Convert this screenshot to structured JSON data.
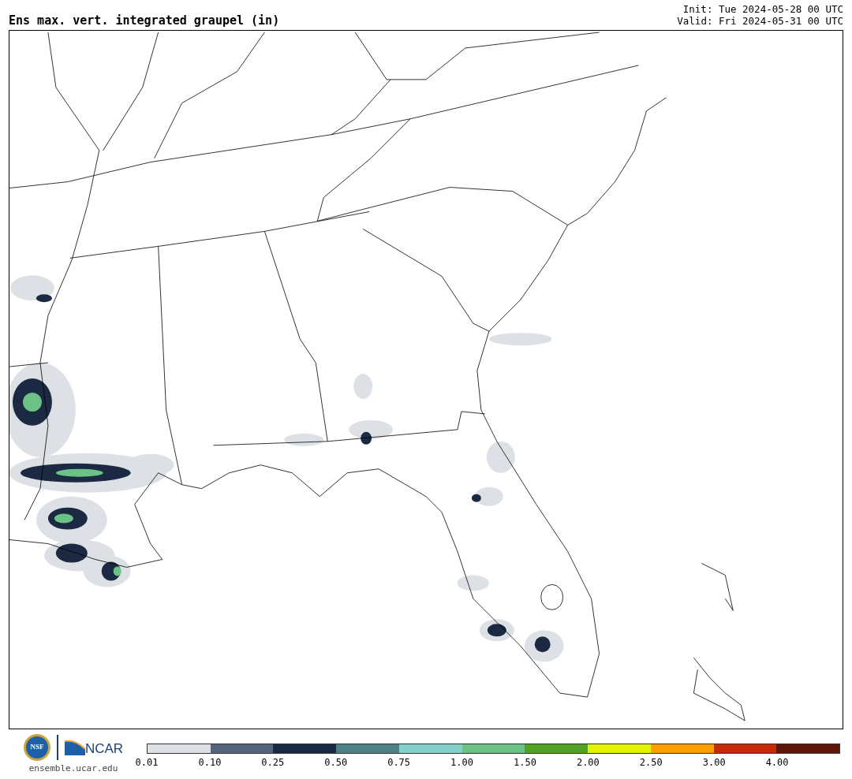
{
  "title": "Ens max. vert. integrated graupel (in)",
  "init": "Init: Tue 2024-05-28 00 UTC",
  "valid": "Valid: Fri 2024-05-31 00 UTC",
  "logos": {
    "seal_text": "NSF",
    "wordmark": "NCAR",
    "site": "ensemble.ucar.edu"
  },
  "legend": {
    "bins": [
      {
        "color": "#dde1e6"
      },
      {
        "color": "#55647a"
      },
      {
        "color": "#1b2a42"
      },
      {
        "color": "#4e8084"
      },
      {
        "color": "#86d0cb"
      },
      {
        "color": "#6cc187"
      },
      {
        "color": "#52a324"
      },
      {
        "color": "#e2f200"
      },
      {
        "color": "#ffa000"
      },
      {
        "color": "#c82a08"
      },
      {
        "color": "#5e160a"
      }
    ],
    "tick_labels": [
      "0.01",
      "0.10",
      "0.25",
      "0.50",
      "0.75",
      "1.00",
      "1.50",
      "2.00",
      "2.50",
      "3.00",
      "4.00"
    ]
  }
}
